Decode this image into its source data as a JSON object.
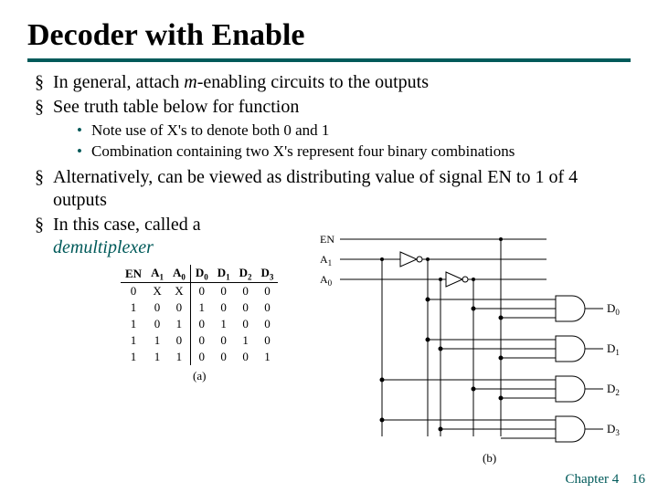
{
  "title": "Decoder with Enable",
  "bullets": {
    "b1_a": "In general, attach ",
    "b1_m": "m",
    "b1_b": "-enabling circuits to the outputs",
    "b2": "See truth table below for function",
    "b2s1": "Note use of X's to denote both 0 and 1",
    "b2s2": "Combination containing two X's represent four binary combinations",
    "b3": "Alternatively, can be viewed as distributing value of signal EN to 1 of 4 outputs",
    "b4_a": "In this case, called a ",
    "b4_b": "demultiplexer"
  },
  "table": {
    "headers": [
      "EN",
      "A",
      "1",
      "A",
      "0",
      "D",
      "0",
      "D",
      "1",
      "D",
      "2",
      "D",
      "3"
    ],
    "rows": [
      [
        "0",
        "X",
        "X",
        "0",
        "0",
        "0",
        "0"
      ],
      [
        "1",
        "0",
        "0",
        "1",
        "0",
        "0",
        "0"
      ],
      [
        "1",
        "0",
        "1",
        "0",
        "1",
        "0",
        "0"
      ],
      [
        "1",
        "1",
        "0",
        "0",
        "0",
        "1",
        "0"
      ],
      [
        "1",
        "1",
        "1",
        "0",
        "0",
        "0",
        "1"
      ]
    ],
    "caption_a": "(a)"
  },
  "circuit": {
    "EN": "EN",
    "A1": "A",
    "A1s": "1",
    "A0": "A",
    "A0s": "0",
    "D0": "D",
    "D0s": "0",
    "D1": "D",
    "D1s": "1",
    "D2": "D",
    "D2s": "2",
    "D3": "D",
    "D3s": "3",
    "caption_b": "(b)"
  },
  "footer": {
    "chapter": "Chapter 4",
    "page": "16"
  }
}
